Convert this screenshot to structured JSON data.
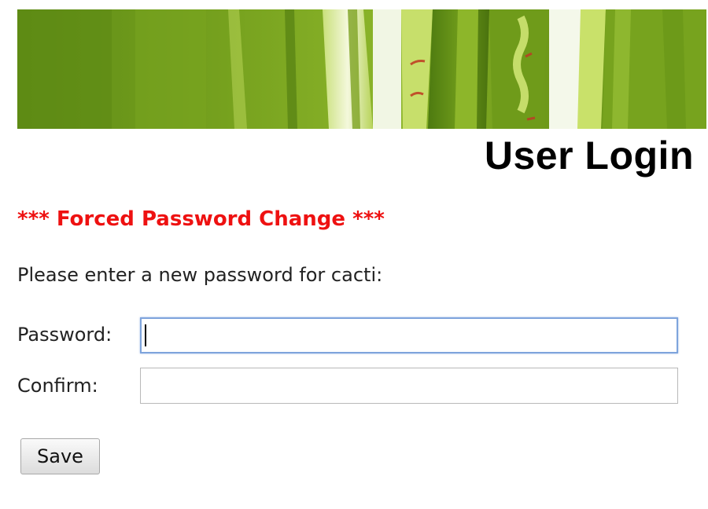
{
  "header": {
    "title": "User Login"
  },
  "notice": {
    "forced_change": "*** Forced Password Change ***"
  },
  "form": {
    "instructions": "Please enter a new password for cacti:",
    "password_label": "Password:",
    "password_value": "",
    "confirm_label": "Confirm:",
    "confirm_value": "",
    "save_label": "Save"
  },
  "colors": {
    "notice_text": "#ee1111",
    "focus_border": "#7ea4dc",
    "banner_green": "#6f9a1a"
  }
}
